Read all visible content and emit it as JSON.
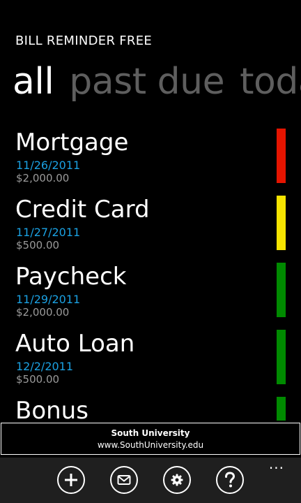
{
  "app": {
    "title": "BILL REMINDER FREE"
  },
  "pivot": {
    "tabs": [
      {
        "label": "all",
        "active": true
      },
      {
        "label": "past due",
        "active": false
      },
      {
        "label": "today",
        "active": false
      }
    ]
  },
  "bills": [
    {
      "name": "Mortgage",
      "date": "11/26/2011",
      "amount": "$2,000.00",
      "status_color": "#e51400"
    },
    {
      "name": "Credit Card",
      "date": "11/27/2011",
      "amount": "$500.00",
      "status_color": "#f6e400"
    },
    {
      "name": "Paycheck",
      "date": "11/29/2011",
      "amount": "$2,000.00",
      "status_color": "#008a00"
    },
    {
      "name": "Auto Loan",
      "date": "12/2/2011",
      "amount": "$500.00",
      "status_color": "#008a00"
    },
    {
      "name": "Bonus",
      "date": "",
      "amount": "",
      "status_color": "#008a00"
    }
  ],
  "ad": {
    "name": "South University",
    "url": "www.SouthUniversity.edu"
  },
  "appbar": {
    "buttons": [
      {
        "icon": "add-icon"
      },
      {
        "icon": "mail-icon"
      },
      {
        "icon": "settings-icon"
      },
      {
        "icon": "help-icon"
      }
    ],
    "more": "..."
  },
  "colors": {
    "accent": "#1ba1e2",
    "background": "#000000",
    "appbar": "#1f1f1f",
    "inactive_pivot": "#5e5e5e"
  }
}
